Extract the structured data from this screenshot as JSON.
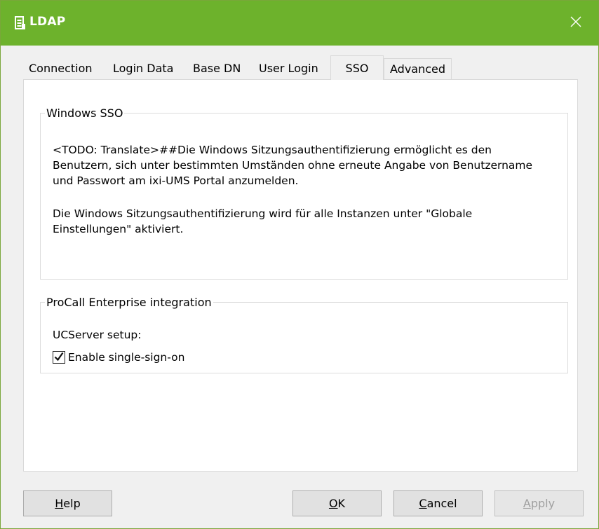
{
  "window": {
    "title": "LDAP",
    "title_icon": "ldap-document-icon",
    "close_icon": "close-icon"
  },
  "tabs": [
    {
      "label": "Connection",
      "active": false
    },
    {
      "label": "Login Data",
      "active": false
    },
    {
      "label": "Base DN",
      "active": false
    },
    {
      "label": "User Login",
      "active": false
    },
    {
      "label": "SSO",
      "active": true
    },
    {
      "label": "Advanced",
      "active": false
    }
  ],
  "windows_sso": {
    "legend": "Windows SSO",
    "paragraph1": "<TODO: Translate>##Die Windows Sitzungsauthentifizierung ermöglicht es den Benutzern, sich unter bestimmten Umständen ohne erneute Angabe von Benutzername und Passwort am ixi-UMS Portal anzumelden.",
    "paragraph2": "Die Windows Sitzungsauthentifizierung wird für alle Instanzen unter \"Globale Einstellungen\" aktiviert."
  },
  "procall": {
    "legend": "ProCall Enterprise integration",
    "ucserver_label": "UCServer setup:",
    "sso_checkbox_label": "Enable single-sign-on",
    "sso_checkbox_checked": true
  },
  "buttons": {
    "help": {
      "prefix": "",
      "mnemonic": "H",
      "rest": "elp"
    },
    "ok": {
      "prefix": "",
      "mnemonic": "O",
      "rest": "K"
    },
    "cancel": {
      "prefix": "",
      "mnemonic": "C",
      "rest": "ancel"
    },
    "apply": {
      "prefix": "",
      "mnemonic": "A",
      "rest": "pply",
      "enabled": false
    }
  },
  "colors": {
    "titlebar": "#6db22c",
    "window_bg": "#f0f0f0",
    "panel_bg": "#ffffff"
  }
}
